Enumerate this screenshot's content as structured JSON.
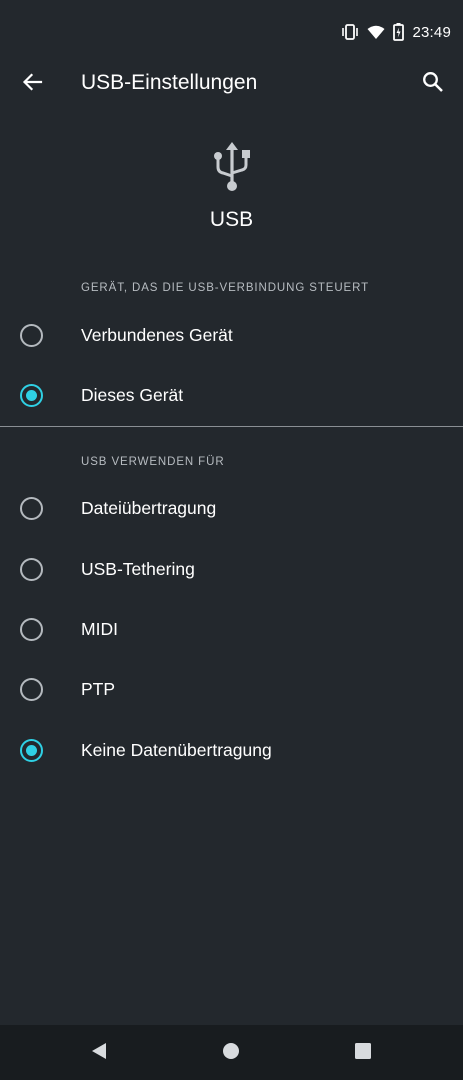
{
  "status_bar": {
    "time": "23:49",
    "icons": [
      "vibrate-icon",
      "wifi-icon",
      "battery-charging-icon"
    ]
  },
  "app_bar": {
    "title": "USB-Einstellungen",
    "back_icon": "arrow-back-icon",
    "search_icon": "search-icon"
  },
  "header": {
    "icon": "usb-icon",
    "title": "USB"
  },
  "sections": [
    {
      "title": "GERÄT, DAS DIE USB-VERBINDUNG STEUERT",
      "options": [
        {
          "label": "Verbundenes Gerät",
          "checked": false
        },
        {
          "label": "Dieses Gerät",
          "checked": true
        }
      ]
    },
    {
      "title": "USB VERWENDEN FÜR",
      "options": [
        {
          "label": "Dateiübertragung",
          "checked": false
        },
        {
          "label": "USB-Tethering",
          "checked": false
        },
        {
          "label": "MIDI",
          "checked": false
        },
        {
          "label": "PTP",
          "checked": false
        },
        {
          "label": "Keine Datenübertragung",
          "checked": true
        }
      ]
    }
  ],
  "nav_bar": {
    "icons": [
      "nav-back-icon",
      "nav-home-icon",
      "nav-recents-icon"
    ]
  },
  "colors": {
    "background": "#23282d",
    "accent": "#2fd0e4",
    "nav_background": "#181c1f"
  }
}
